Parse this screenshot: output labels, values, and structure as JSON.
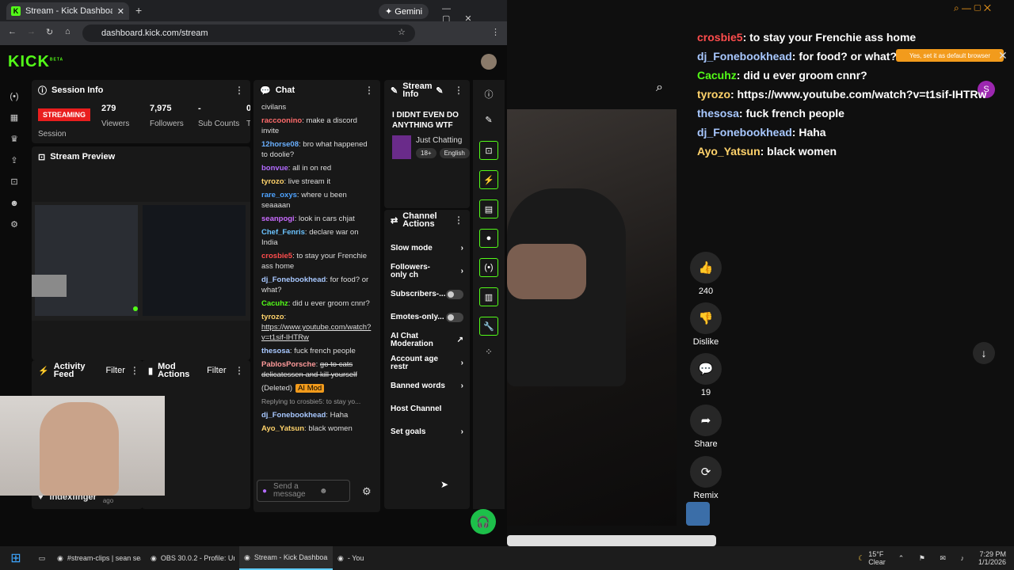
{
  "browser": {
    "tab_title": "Stream - Kick Dashboard",
    "gemini_label": "Gemini",
    "url": "dashboard.kick.com/stream"
  },
  "kick": {
    "logo": "KICK",
    "beta": "BETA"
  },
  "session": {
    "title": "Session Info",
    "status": "STREAMING",
    "stats": [
      {
        "value": "279",
        "label": "Viewers"
      },
      {
        "value": "7,975",
        "label": "Followers"
      },
      {
        "value": "-",
        "label": "Sub Counts"
      },
      {
        "value": "00",
        "label": "Ti"
      }
    ],
    "session_label": "Session"
  },
  "preview": {
    "title": "Stream Preview"
  },
  "activity": {
    "title": "Activity Feed",
    "filter": "Filter",
    "item_user": "indexfinger",
    "item_time": "minutes ago"
  },
  "mod": {
    "title": "Mod Actions",
    "filter": "Filter"
  },
  "chat": {
    "title": "Chat",
    "messages": [
      {
        "user": "",
        "text": "civilans",
        "color": "#ddd"
      },
      {
        "user": "raccoonino",
        "text": "make a discord invite",
        "color": "#ff6b6b"
      },
      {
        "user": "12horse08",
        "text": "bro what happened to doolie?",
        "color": "#6ab0ff"
      },
      {
        "user": "bonvue",
        "text": "all in on red",
        "color": "#b36bff"
      },
      {
        "user": "tyrozo",
        "text": "live stream it",
        "color": "#ffd36b"
      },
      {
        "user": "rare_oxys",
        "text": "where u been seaaaan",
        "color": "#4ea3ff"
      },
      {
        "user": "seanpogi",
        "text": "look in cars chjat",
        "color": "#c96bff"
      },
      {
        "user": "Chef_Fenris",
        "text": "declare war on India",
        "color": "#6bc3ff"
      },
      {
        "user": "crosbie5",
        "text": "to stay your Frenchie ass home",
        "color": "#ff4d4d"
      },
      {
        "user": "dj_Fonebookhead",
        "text": "for food? or what?",
        "color": "#a8c8ff"
      },
      {
        "user": "Cacuhz",
        "text": "did u ever groom cnnr?",
        "color": "#53fc18"
      },
      {
        "user": "tyrozo",
        "text": "https://www.youtube.com/watch?v=t1sif-IHTRw",
        "color": "#ffd36b"
      },
      {
        "user": "thesosa",
        "text": "fuck french people",
        "color": "#a8c8ff"
      },
      {
        "user": "PablosPorsche",
        "text": "go to cats delicatessen and kill yourself",
        "color": "#ff9a9a"
      }
    ],
    "deleted": "(Deleted)",
    "ai_mod": "AI Mod",
    "reply_to": "Replying to crosbie5: to stay yo...",
    "after": [
      {
        "user": "dj_Fonebookhead",
        "text": "Haha",
        "color": "#a8c8ff"
      },
      {
        "user": "Ayo_Yatsun",
        "text": "black women",
        "color": "#ffd36b"
      }
    ],
    "input_placeholder": "Send a message"
  },
  "stream_info": {
    "title": "Stream Info",
    "stream_title": "I DIDNT EVEN DO ANYTHING WTF",
    "category": "Just Chatting",
    "tags": [
      "18+",
      "English"
    ]
  },
  "channel_actions": {
    "title": "Channel Actions",
    "items": [
      {
        "label": "Slow mode",
        "kind": "arrow"
      },
      {
        "label": "Followers-only ch",
        "kind": "arrow"
      },
      {
        "label": "Subscribers-...",
        "kind": "toggle"
      },
      {
        "label": "Emotes-only...",
        "kind": "toggle"
      },
      {
        "label": "AI Chat Moderation",
        "kind": "ext"
      },
      {
        "label": "Account age restr",
        "kind": "arrow"
      },
      {
        "label": "Banned words",
        "kind": "arrow"
      },
      {
        "label": "Host Channel",
        "kind": "none"
      },
      {
        "label": "Set goals",
        "kind": "arrow"
      }
    ]
  },
  "overlay_chat": [
    {
      "user": "crosbie5",
      "text": ": to stay your Frenchie ass home",
      "color": "#ff4d4d"
    },
    {
      "user": "dj_Fonebookhead",
      "text": ": for food? or what?",
      "color": "#a8c8ff"
    },
    {
      "user": "Cacuhz",
      "text": ": did u ever groom cnnr?",
      "color": "#53fc18"
    },
    {
      "user": "tyrozo",
      "text": ": https://www.youtube.com/watch?v=t1sif-IHTRw",
      "color": "#ffd36b"
    },
    {
      "user": "thesosa",
      "text": ": fuck french people",
      "color": "#a8c8ff"
    },
    {
      "user": "dj_Fonebookhead",
      "text": ": Haha",
      "color": "#a8c8ff"
    },
    {
      "user": "Ayo_Yatsun",
      "text": ": black women",
      "color": "#ffd36b"
    }
  ],
  "default_browser": "Yes, set it as default browser",
  "shorts": {
    "likes": "240",
    "dislike": "Dislike",
    "comments": "19",
    "share": "Share",
    "remix": "Remix"
  },
  "taskbar": {
    "items": [
      "#stream-clips | sean sea",
      "OBS 30.0.2 - Profile: Unt",
      "Stream - Kick Dashboar",
      "- You"
    ],
    "weather_temp": "15°F",
    "weather_desc": "Clear",
    "time": "7:29 PM",
    "date": "1/1/2026"
  }
}
